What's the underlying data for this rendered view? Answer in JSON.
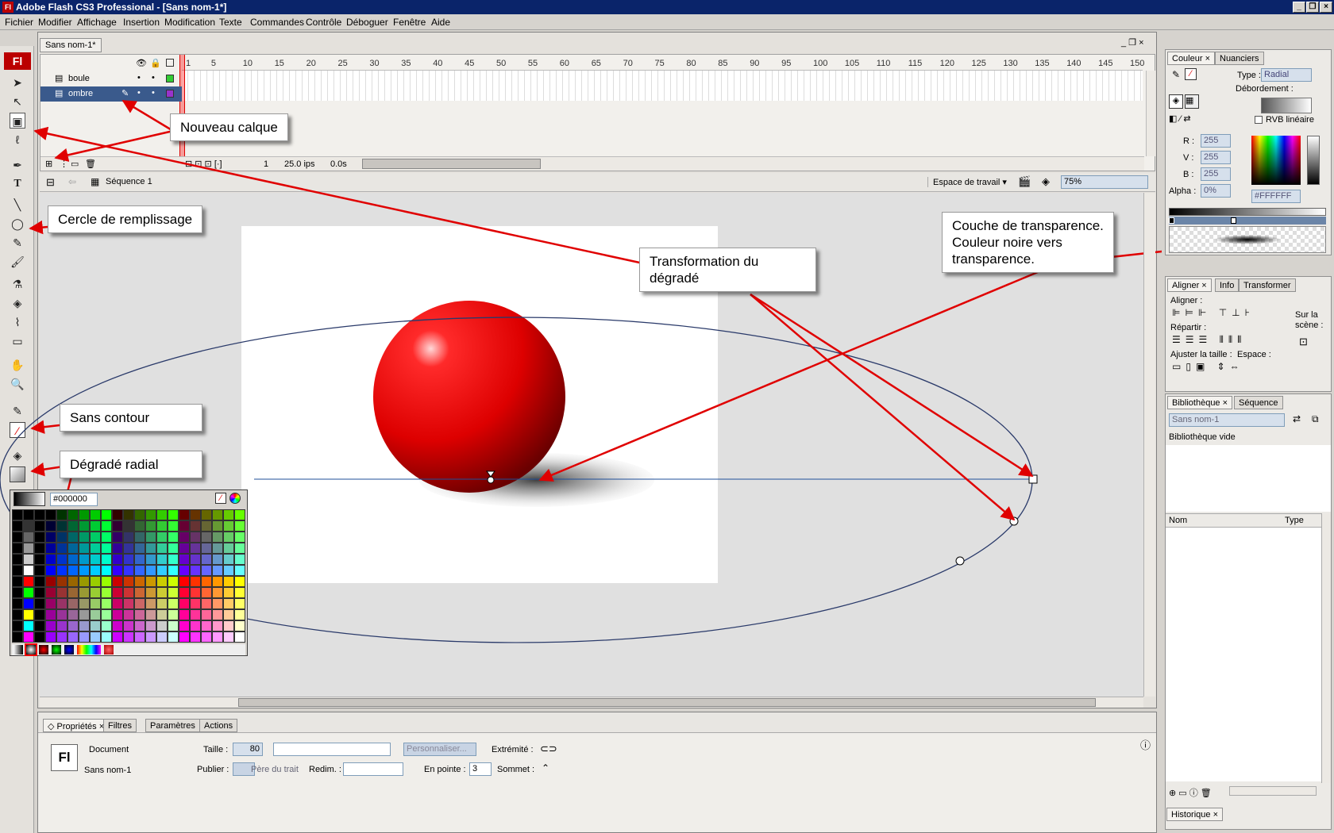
{
  "window": {
    "title": "Adobe Flash CS3 Professional - [Sans nom-1*]",
    "app_icon": "Fl"
  },
  "menubar": [
    "Fichier",
    "Modifier",
    "Affichage",
    "Insertion",
    "Modification",
    "Texte",
    "Commandes",
    "Contrôle",
    "Déboguer",
    "Fenêtre",
    "Aide"
  ],
  "document": {
    "tab": "Sans nom-1*"
  },
  "timeline": {
    "layers": [
      {
        "name": "boule",
        "color": "#33cc33"
      },
      {
        "name": "ombre",
        "color": "#9933cc"
      }
    ],
    "frame_numbers": [
      "1",
      "5",
      "10",
      "15",
      "20",
      "25",
      "30",
      "35",
      "40",
      "45",
      "50",
      "55",
      "60",
      "65",
      "70",
      "75",
      "80",
      "85",
      "90",
      "95",
      "100",
      "105",
      "110",
      "115",
      "120",
      "125",
      "130",
      "135",
      "140",
      "145",
      "150"
    ],
    "current_frame": "1",
    "fps": "25.0 ips",
    "time": "0.0s"
  },
  "scene": {
    "name": "Séquence 1",
    "workspace": "Espace de travail ▾",
    "zoom": "75%"
  },
  "callouts": {
    "new_layer": "Nouveau calque",
    "fill_circle": "Cercle de remplissage",
    "no_stroke": "Sans contour",
    "radial": "Dégradé radial",
    "gradient_transform": "Transformation du\ndégradé",
    "transparency": "Couche de transparence.\nCouleur noire vers\ntransparence."
  },
  "palette": {
    "hex": "#000000"
  },
  "properties": {
    "tabs": [
      "Propriétés",
      "Filtres",
      "Paramètres",
      "Actions"
    ],
    "doc_label": "Document",
    "doc_name": "Sans nom-1",
    "taille_label": "Taille :",
    "taille_value": "80",
    "publier_label": "Publier :",
    "pere_trait": "Père du trait",
    "redim_label": "Redim. :",
    "personnaliser": "Personnaliser...",
    "extremite_label": "Extrémité :",
    "en_pointe_label": "En pointe :",
    "en_pointe_value": "3",
    "sommet_label": "Sommet :"
  },
  "color_panel": {
    "tabs": [
      "Couleur",
      "Nuanciers"
    ],
    "type_label": "Type :",
    "type_value": "Radial",
    "overflow_label": "Débordement :",
    "linear_rgb": "RVB linéaire",
    "r_label": "R :",
    "r_value": "255",
    "v_label": "V :",
    "v_value": "255",
    "b_label": "B :",
    "b_value": "255",
    "alpha_label": "Alpha :",
    "alpha_value": "0%",
    "hex_value": "#FFFFFF"
  },
  "align_panel": {
    "tabs": [
      "Aligner",
      "Info",
      "Transformer"
    ],
    "align_label": "Aligner :",
    "distribute_label": "Répartir :",
    "match_label": "Ajuster la taille :",
    "space_label": "Espace :",
    "stage_label": "Sur la\nscène :"
  },
  "library_panel": {
    "tabs": [
      "Bibliothèque",
      "Séquence"
    ],
    "doc": "Sans nom-1",
    "empty": "Bibliothèque vide",
    "col_name": "Nom",
    "col_type": "Type"
  },
  "history_panel": {
    "tab": "Historique"
  }
}
